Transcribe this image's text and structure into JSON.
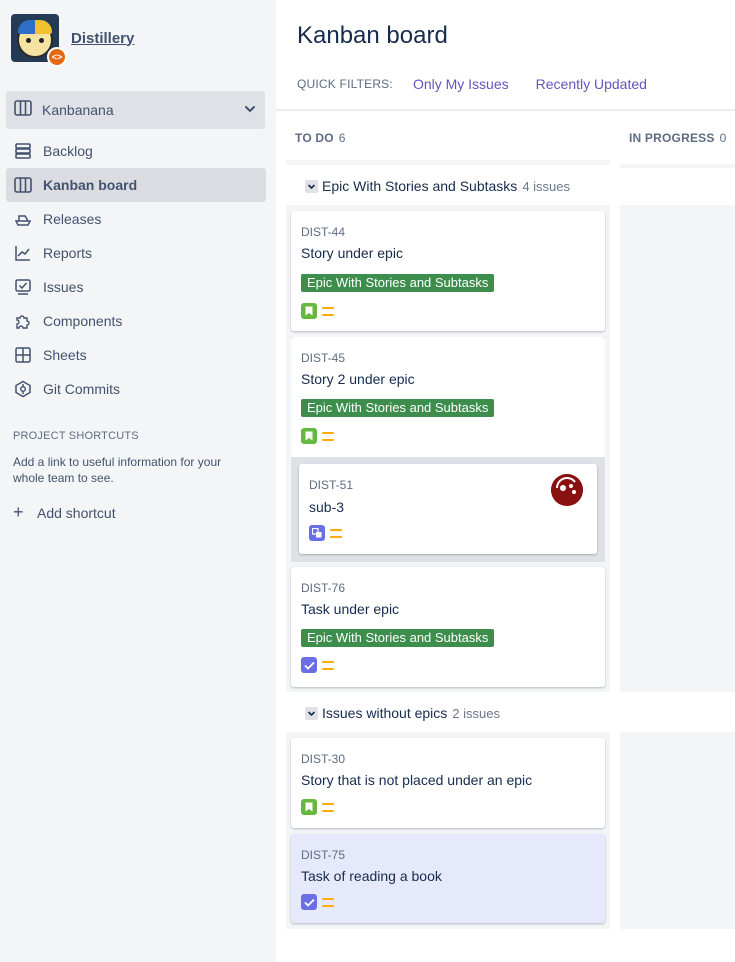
{
  "sidebar": {
    "project_name": "Distillery",
    "board_name": "Kanbanana",
    "nav": [
      {
        "label": "Backlog",
        "icon": "backlog-icon"
      },
      {
        "label": "Kanban board",
        "icon": "board-icon",
        "active": true
      },
      {
        "label": "Releases",
        "icon": "ship-icon"
      },
      {
        "label": "Reports",
        "icon": "chart-icon"
      },
      {
        "label": "Issues",
        "icon": "issues-icon"
      },
      {
        "label": "Components",
        "icon": "puzzle-icon"
      },
      {
        "label": "Sheets",
        "icon": "sheets-icon"
      },
      {
        "label": "Git Commits",
        "icon": "git-icon"
      }
    ],
    "shortcuts_heading": "PROJECT SHORTCUTS",
    "shortcuts_desc": "Add a link to useful information for your whole team to see.",
    "add_shortcut": "Add shortcut"
  },
  "header": {
    "title": "Kanban board",
    "quick_filters_label": "QUICK FILTERS:",
    "filters": [
      "Only My Issues",
      "Recently Updated"
    ]
  },
  "columns": [
    {
      "name": "TO DO",
      "count": "6"
    },
    {
      "name": "IN PROGRESS",
      "count": "0"
    }
  ],
  "swimlanes": [
    {
      "name": "Epic With Stories and Subtasks",
      "count": "4 issues"
    },
    {
      "name": "Issues without epics",
      "count": "2 issues"
    }
  ],
  "cards": [
    {
      "key": "DIST-44",
      "summary": "Story under epic",
      "epic": "Epic With Stories and Subtasks",
      "type": "story"
    },
    {
      "key": "DIST-45",
      "summary": "Story 2 under epic",
      "epic": "Epic With Stories and Subtasks",
      "type": "story"
    },
    {
      "key": "DIST-51",
      "summary": "sub-3",
      "type": "subtask"
    },
    {
      "key": "DIST-76",
      "summary": "Task under epic",
      "epic": "Epic With Stories and Subtasks",
      "type": "task"
    },
    {
      "key": "DIST-30",
      "summary": "Story that is not placed under an epic",
      "type": "story"
    },
    {
      "key": "DIST-75",
      "summary": "Task of reading a book",
      "type": "task"
    }
  ],
  "colors": {
    "epic_label": "#3d8d4d",
    "filter_link": "#6554c0",
    "priority_medium": "#ffab00",
    "selected_card": "#e6e9fb"
  }
}
